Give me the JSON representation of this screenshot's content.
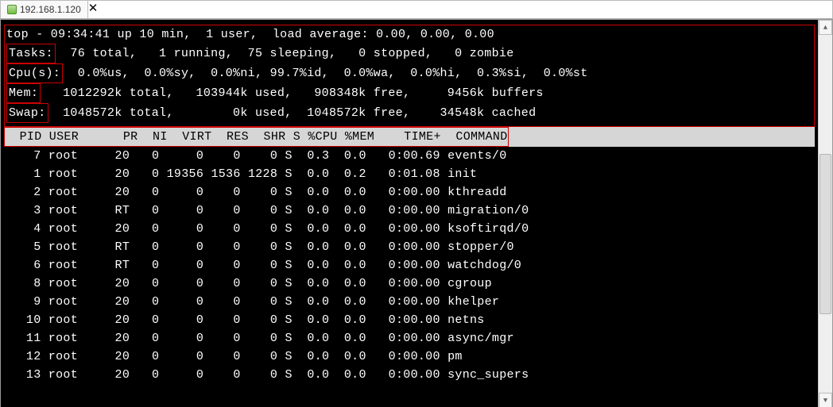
{
  "tab_title": "192.168.1.120",
  "summary": {
    "line1": "top - 09:34:41 up 10 min,  1 user,  load average: 0.00, 0.00, 0.00",
    "tasks_label": "Tasks:",
    "tasks_rest": "  76 total,   1 running,  75 sleeping,   0 stopped,   0 zombie",
    "cpu_label": "Cpu(s):",
    "cpu_rest": "  0.0%us,  0.0%sy,  0.0%ni, 99.7%id,  0.0%wa,  0.0%hi,  0.3%si,  0.0%st",
    "mem_label": "Mem:",
    "mem_rest": "   1012292k total,   103944k used,   908348k free,     9456k buffers",
    "swap_label": "Swap:",
    "swap_rest": "  1048572k total,        0k used,  1048572k free,    34548k cached"
  },
  "header": "  PID USER      PR  NI  VIRT  RES  SHR S %CPU %MEM    TIME+  COMMAND",
  "processes": [
    {
      "pid": "    7",
      "user": "root",
      "pr": "20",
      "ni": "  0",
      "virt": "    0",
      "res": "   0",
      "shr": "   0",
      "s": "S",
      "cpu": " 0.3",
      "mem": " 0.0",
      "time": "  0:00.69",
      "cmd": "events/0"
    },
    {
      "pid": "    1",
      "user": "root",
      "pr": "20",
      "ni": "  0",
      "virt": "19356",
      "res": "1536",
      "shr": "1228",
      "s": "S",
      "cpu": " 0.0",
      "mem": " 0.2",
      "time": "  0:01.08",
      "cmd": "init"
    },
    {
      "pid": "    2",
      "user": "root",
      "pr": "20",
      "ni": "  0",
      "virt": "    0",
      "res": "   0",
      "shr": "   0",
      "s": "S",
      "cpu": " 0.0",
      "mem": " 0.0",
      "time": "  0:00.00",
      "cmd": "kthreadd"
    },
    {
      "pid": "    3",
      "user": "root",
      "pr": "RT",
      "ni": "  0",
      "virt": "    0",
      "res": "   0",
      "shr": "   0",
      "s": "S",
      "cpu": " 0.0",
      "mem": " 0.0",
      "time": "  0:00.00",
      "cmd": "migration/0"
    },
    {
      "pid": "    4",
      "user": "root",
      "pr": "20",
      "ni": "  0",
      "virt": "    0",
      "res": "   0",
      "shr": "   0",
      "s": "S",
      "cpu": " 0.0",
      "mem": " 0.0",
      "time": "  0:00.00",
      "cmd": "ksoftirqd/0"
    },
    {
      "pid": "    5",
      "user": "root",
      "pr": "RT",
      "ni": "  0",
      "virt": "    0",
      "res": "   0",
      "shr": "   0",
      "s": "S",
      "cpu": " 0.0",
      "mem": " 0.0",
      "time": "  0:00.00",
      "cmd": "stopper/0"
    },
    {
      "pid": "    6",
      "user": "root",
      "pr": "RT",
      "ni": "  0",
      "virt": "    0",
      "res": "   0",
      "shr": "   0",
      "s": "S",
      "cpu": " 0.0",
      "mem": " 0.0",
      "time": "  0:00.00",
      "cmd": "watchdog/0"
    },
    {
      "pid": "    8",
      "user": "root",
      "pr": "20",
      "ni": "  0",
      "virt": "    0",
      "res": "   0",
      "shr": "   0",
      "s": "S",
      "cpu": " 0.0",
      "mem": " 0.0",
      "time": "  0:00.00",
      "cmd": "cgroup"
    },
    {
      "pid": "    9",
      "user": "root",
      "pr": "20",
      "ni": "  0",
      "virt": "    0",
      "res": "   0",
      "shr": "   0",
      "s": "S",
      "cpu": " 0.0",
      "mem": " 0.0",
      "time": "  0:00.00",
      "cmd": "khelper"
    },
    {
      "pid": "   10",
      "user": "root",
      "pr": "20",
      "ni": "  0",
      "virt": "    0",
      "res": "   0",
      "shr": "   0",
      "s": "S",
      "cpu": " 0.0",
      "mem": " 0.0",
      "time": "  0:00.00",
      "cmd": "netns"
    },
    {
      "pid": "   11",
      "user": "root",
      "pr": "20",
      "ni": "  0",
      "virt": "    0",
      "res": "   0",
      "shr": "   0",
      "s": "S",
      "cpu": " 0.0",
      "mem": " 0.0",
      "time": "  0:00.00",
      "cmd": "async/mgr"
    },
    {
      "pid": "   12",
      "user": "root",
      "pr": "20",
      "ni": "  0",
      "virt": "    0",
      "res": "   0",
      "shr": "   0",
      "s": "S",
      "cpu": " 0.0",
      "mem": " 0.0",
      "time": "  0:00.00",
      "cmd": "pm"
    },
    {
      "pid": "   13",
      "user": "root",
      "pr": "20",
      "ni": "  0",
      "virt": "    0",
      "res": "   0",
      "shr": "   0",
      "s": "S",
      "cpu": " 0.0",
      "mem": " 0.0",
      "time": "  0:00.00",
      "cmd": "sync_supers"
    }
  ]
}
